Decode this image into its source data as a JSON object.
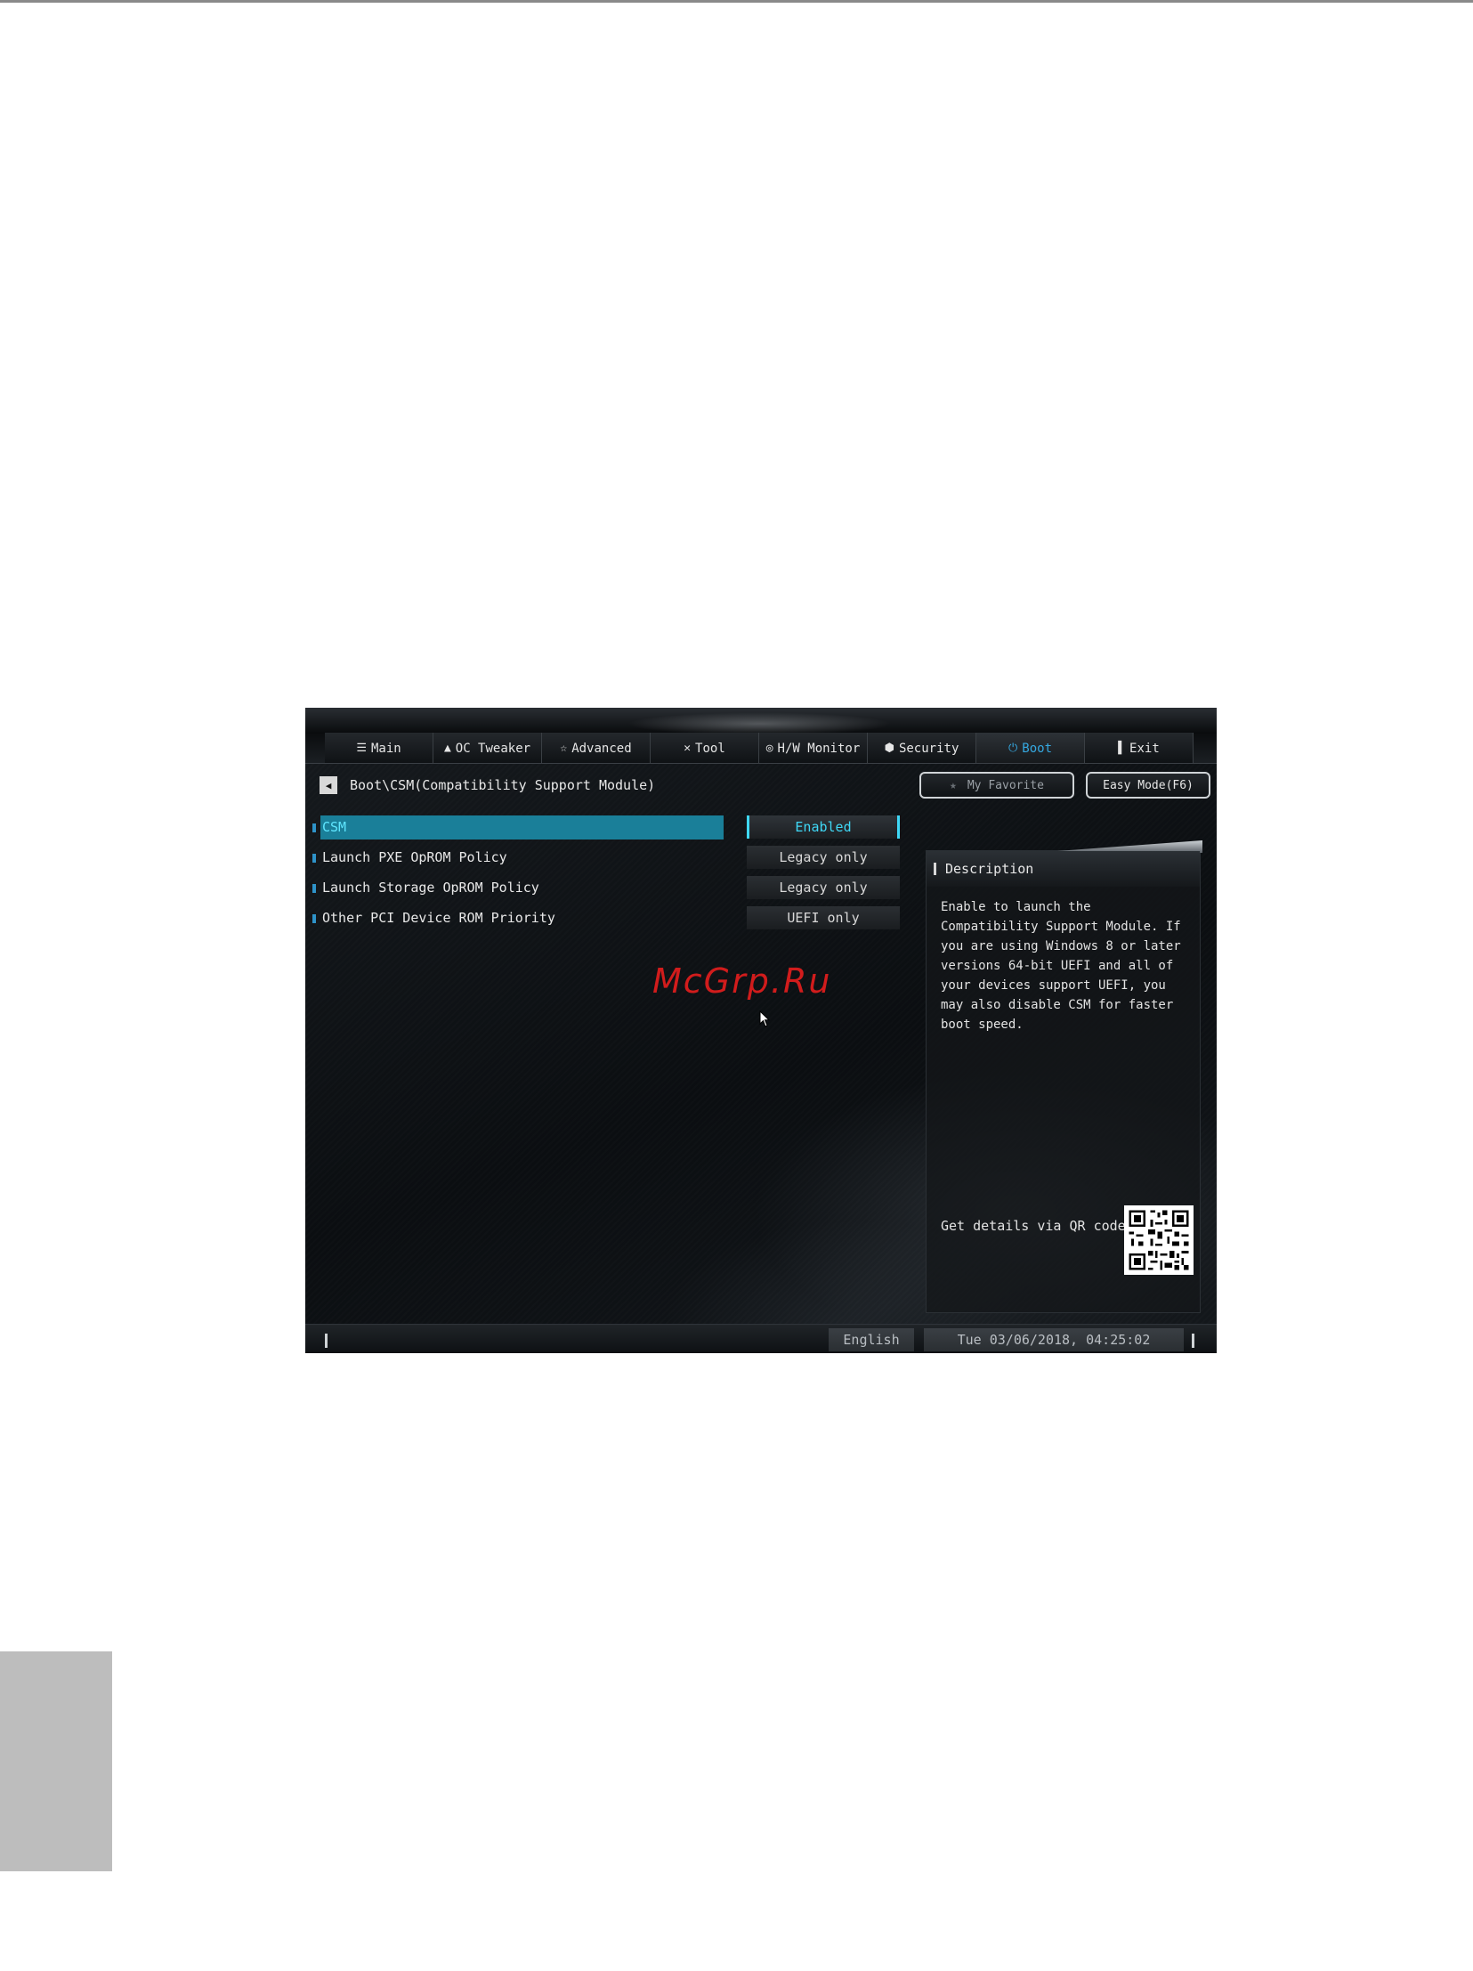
{
  "tabs": [
    {
      "label": "Main",
      "icon": "list-icon"
    },
    {
      "label": "OC Tweaker",
      "icon": "rocket-icon"
    },
    {
      "label": "Advanced",
      "icon": "star-icon"
    },
    {
      "label": "Tool",
      "icon": "tools-icon"
    },
    {
      "label": "H/W Monitor",
      "icon": "monitor-icon"
    },
    {
      "label": "Security",
      "icon": "shield-icon"
    },
    {
      "label": "Boot",
      "icon": "power-icon"
    },
    {
      "label": "Exit",
      "icon": "exit-icon"
    }
  ],
  "active_tab": "Boot",
  "accent_color": "#35a8e0",
  "selection_color": "#1a7f99",
  "breadcrumb": "Boot\\CSM(Compatibility Support Module)",
  "buttons": {
    "favorite": "My Favorite",
    "easy_mode": "Easy Mode(F6)"
  },
  "settings": [
    {
      "label": "CSM",
      "value": "Enabled"
    },
    {
      "label": "Launch PXE OpROM Policy",
      "value": "Legacy only"
    },
    {
      "label": "Launch Storage OpROM Policy",
      "value": "Legacy only"
    },
    {
      "label": "Other PCI Device ROM Priority",
      "value": "UEFI only"
    }
  ],
  "description": {
    "title": "Description",
    "text": "Enable to launch the\nCompatibility Support Module. If\nyou are using Windows 8 or later\nversions 64-bit UEFI and all of\nyour devices support UEFI, you\nmay also disable CSM for faster\nboot speed.",
    "qr_label": "Get details via QR code"
  },
  "watermark": "McGrp.Ru",
  "status": {
    "language": "English",
    "datetime": "Tue 03/06/2018, 04:25:02"
  }
}
